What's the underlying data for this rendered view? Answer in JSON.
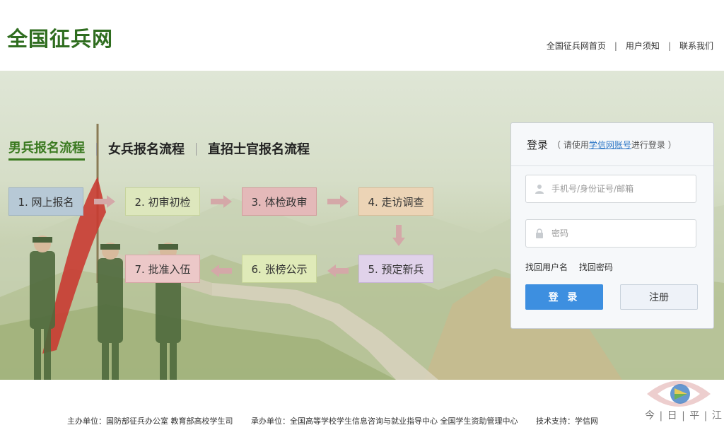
{
  "site": {
    "logo": "全国征兵网"
  },
  "topnav": {
    "home": "全国征兵网首页",
    "notice": "用户须知",
    "contact": "联系我们",
    "sep": "|"
  },
  "tabs": {
    "male": "男兵报名流程",
    "female": "女兵报名流程",
    "direct": "直招士官报名流程"
  },
  "steps": [
    {
      "label": "1. 网上报名",
      "bg": "#b7c9d6",
      "border": "#9fb3c4"
    },
    {
      "label": "2. 初审初检",
      "bg": "#dde7bd",
      "border": "#c7d49d"
    },
    {
      "label": "3. 体检政审",
      "bg": "#e4b9b9",
      "border": "#d39d9d"
    },
    {
      "label": "4. 走访调查",
      "bg": "#ecd4b6",
      "border": "#d9bd9a"
    },
    {
      "label": "5. 预定新兵",
      "bg": "#e0d2ea",
      "border": "#c9b6d8"
    },
    {
      "label": "6. 张榜公示",
      "bg": "#dfeab8",
      "border": "#c7d59a"
    },
    {
      "label": "7. 批准入伍",
      "bg": "#ecc8c8",
      "border": "#d8a9a9"
    }
  ],
  "colors": {
    "arrow": "#d4a8a8",
    "accent": "#3b7a21",
    "link": "#2a74c5",
    "login_btn": "#3d8fe0"
  },
  "login": {
    "title": "登录",
    "hint_pre": "（ 请使用",
    "hint_link": "学信网账号",
    "hint_post": "进行登录 ）",
    "username_placeholder": "手机号/身份证号/邮箱",
    "password_placeholder": "密码",
    "forgot_username": "找回用户名",
    "forgot_password": "找回密码",
    "login_button": "登 录",
    "register_button": "注册"
  },
  "footer": {
    "host": "主办单位：国防部征兵办公室    教育部高校学生司",
    "organizer": "承办单位：全国高等学校学生信息咨询与就业指导中心    全国学生资助管理中心",
    "tech": "技术支持：学信网"
  },
  "watermark": {
    "text": "今 | 日 | 平 | 江"
  }
}
